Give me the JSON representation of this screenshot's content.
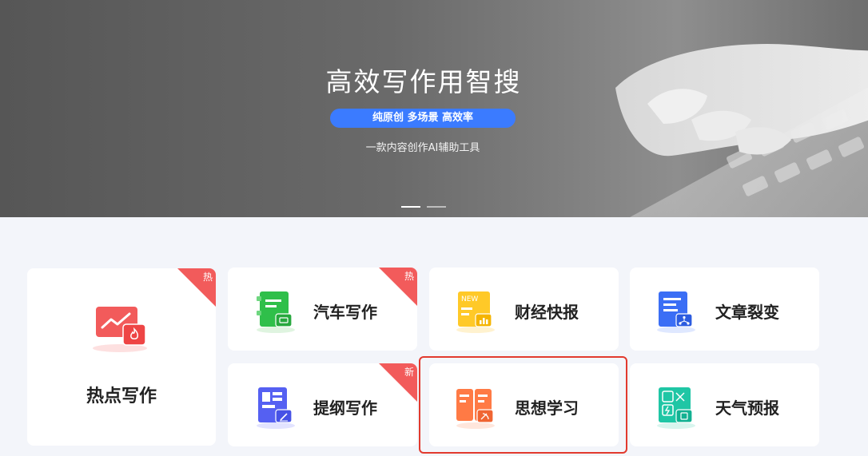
{
  "banner": {
    "title": "高效写作用智搜",
    "tagline": "纯原创 多场景 高效率",
    "subtitle": "一款内容创作AI辅助工具",
    "carousel_active_index": 0,
    "accent_color": "#3b7bff"
  },
  "tools": {
    "hot_writing": {
      "label": "热点写作",
      "badge": "热",
      "icon": "trending-monitor-icon"
    },
    "car_writing": {
      "label": "汽车写作",
      "badge": "热",
      "icon": "car-document-icon"
    },
    "finance_news": {
      "label": "财经快报",
      "badge_inline": "NEW",
      "icon": "finance-chart-icon"
    },
    "article_split": {
      "label": "文章裂变",
      "icon": "article-split-icon"
    },
    "outline_writing": {
      "label": "提纲写作",
      "badge": "新",
      "icon": "outline-edit-icon"
    },
    "thought_study": {
      "label": "思想学习",
      "icon": "study-book-icon"
    },
    "weather_report": {
      "label": "天气预报",
      "icon": "weather-grid-icon"
    }
  },
  "colors": {
    "badge_red": "#f25b5b",
    "highlight_border": "#e23a2e"
  }
}
